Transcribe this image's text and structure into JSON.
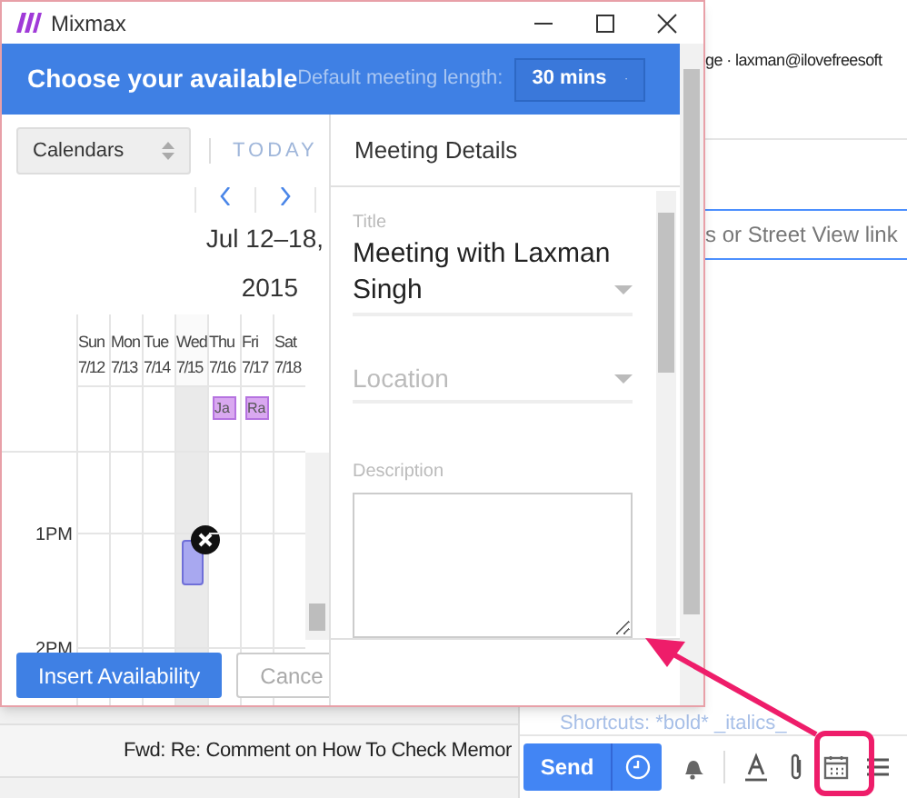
{
  "window": {
    "title": "Mixmax"
  },
  "header": {
    "title": "Choose your available",
    "length_label": "Default meeting length:",
    "length_value": "30 mins"
  },
  "calendar": {
    "select": "Calendars",
    "today": "TODAY",
    "range": "Jul 12–18,",
    "year": "2015",
    "days": [
      {
        "name": "Sun",
        "date": "7/12",
        "selected": false,
        "slot": false
      },
      {
        "name": "Mon",
        "date": "7/13",
        "selected": false,
        "slot": false
      },
      {
        "name": "Tue",
        "date": "7/14",
        "selected": false,
        "slot": false
      },
      {
        "name": "Wed",
        "date": "7/15",
        "selected": true,
        "slot": true
      },
      {
        "name": "Thu",
        "date": "7/16",
        "selected": false,
        "event": "Ja",
        "slot": false
      },
      {
        "name": "Fri",
        "date": "7/17",
        "selected": false,
        "event": "Ra",
        "slot": false
      },
      {
        "name": "Sat",
        "date": "7/18",
        "selected": false,
        "slot": false
      }
    ],
    "times": [
      "1PM",
      "2PM"
    ],
    "insert_button": "Insert Availability",
    "cancel_button": "Cance"
  },
  "details": {
    "heading": "Meeting Details",
    "title_label": "Title",
    "title_value": "Meeting with Laxman Singh",
    "location_placeholder": "Location",
    "description_label": "Description"
  },
  "background": {
    "from": "ge · laxman@ilovefreesoft",
    "location_field": "s or Street View link",
    "subject": "Fwd: Re: Comment on How To Check Memor",
    "shortcuts": "Shortcuts: *bold* _italics_",
    "send": "Send"
  }
}
